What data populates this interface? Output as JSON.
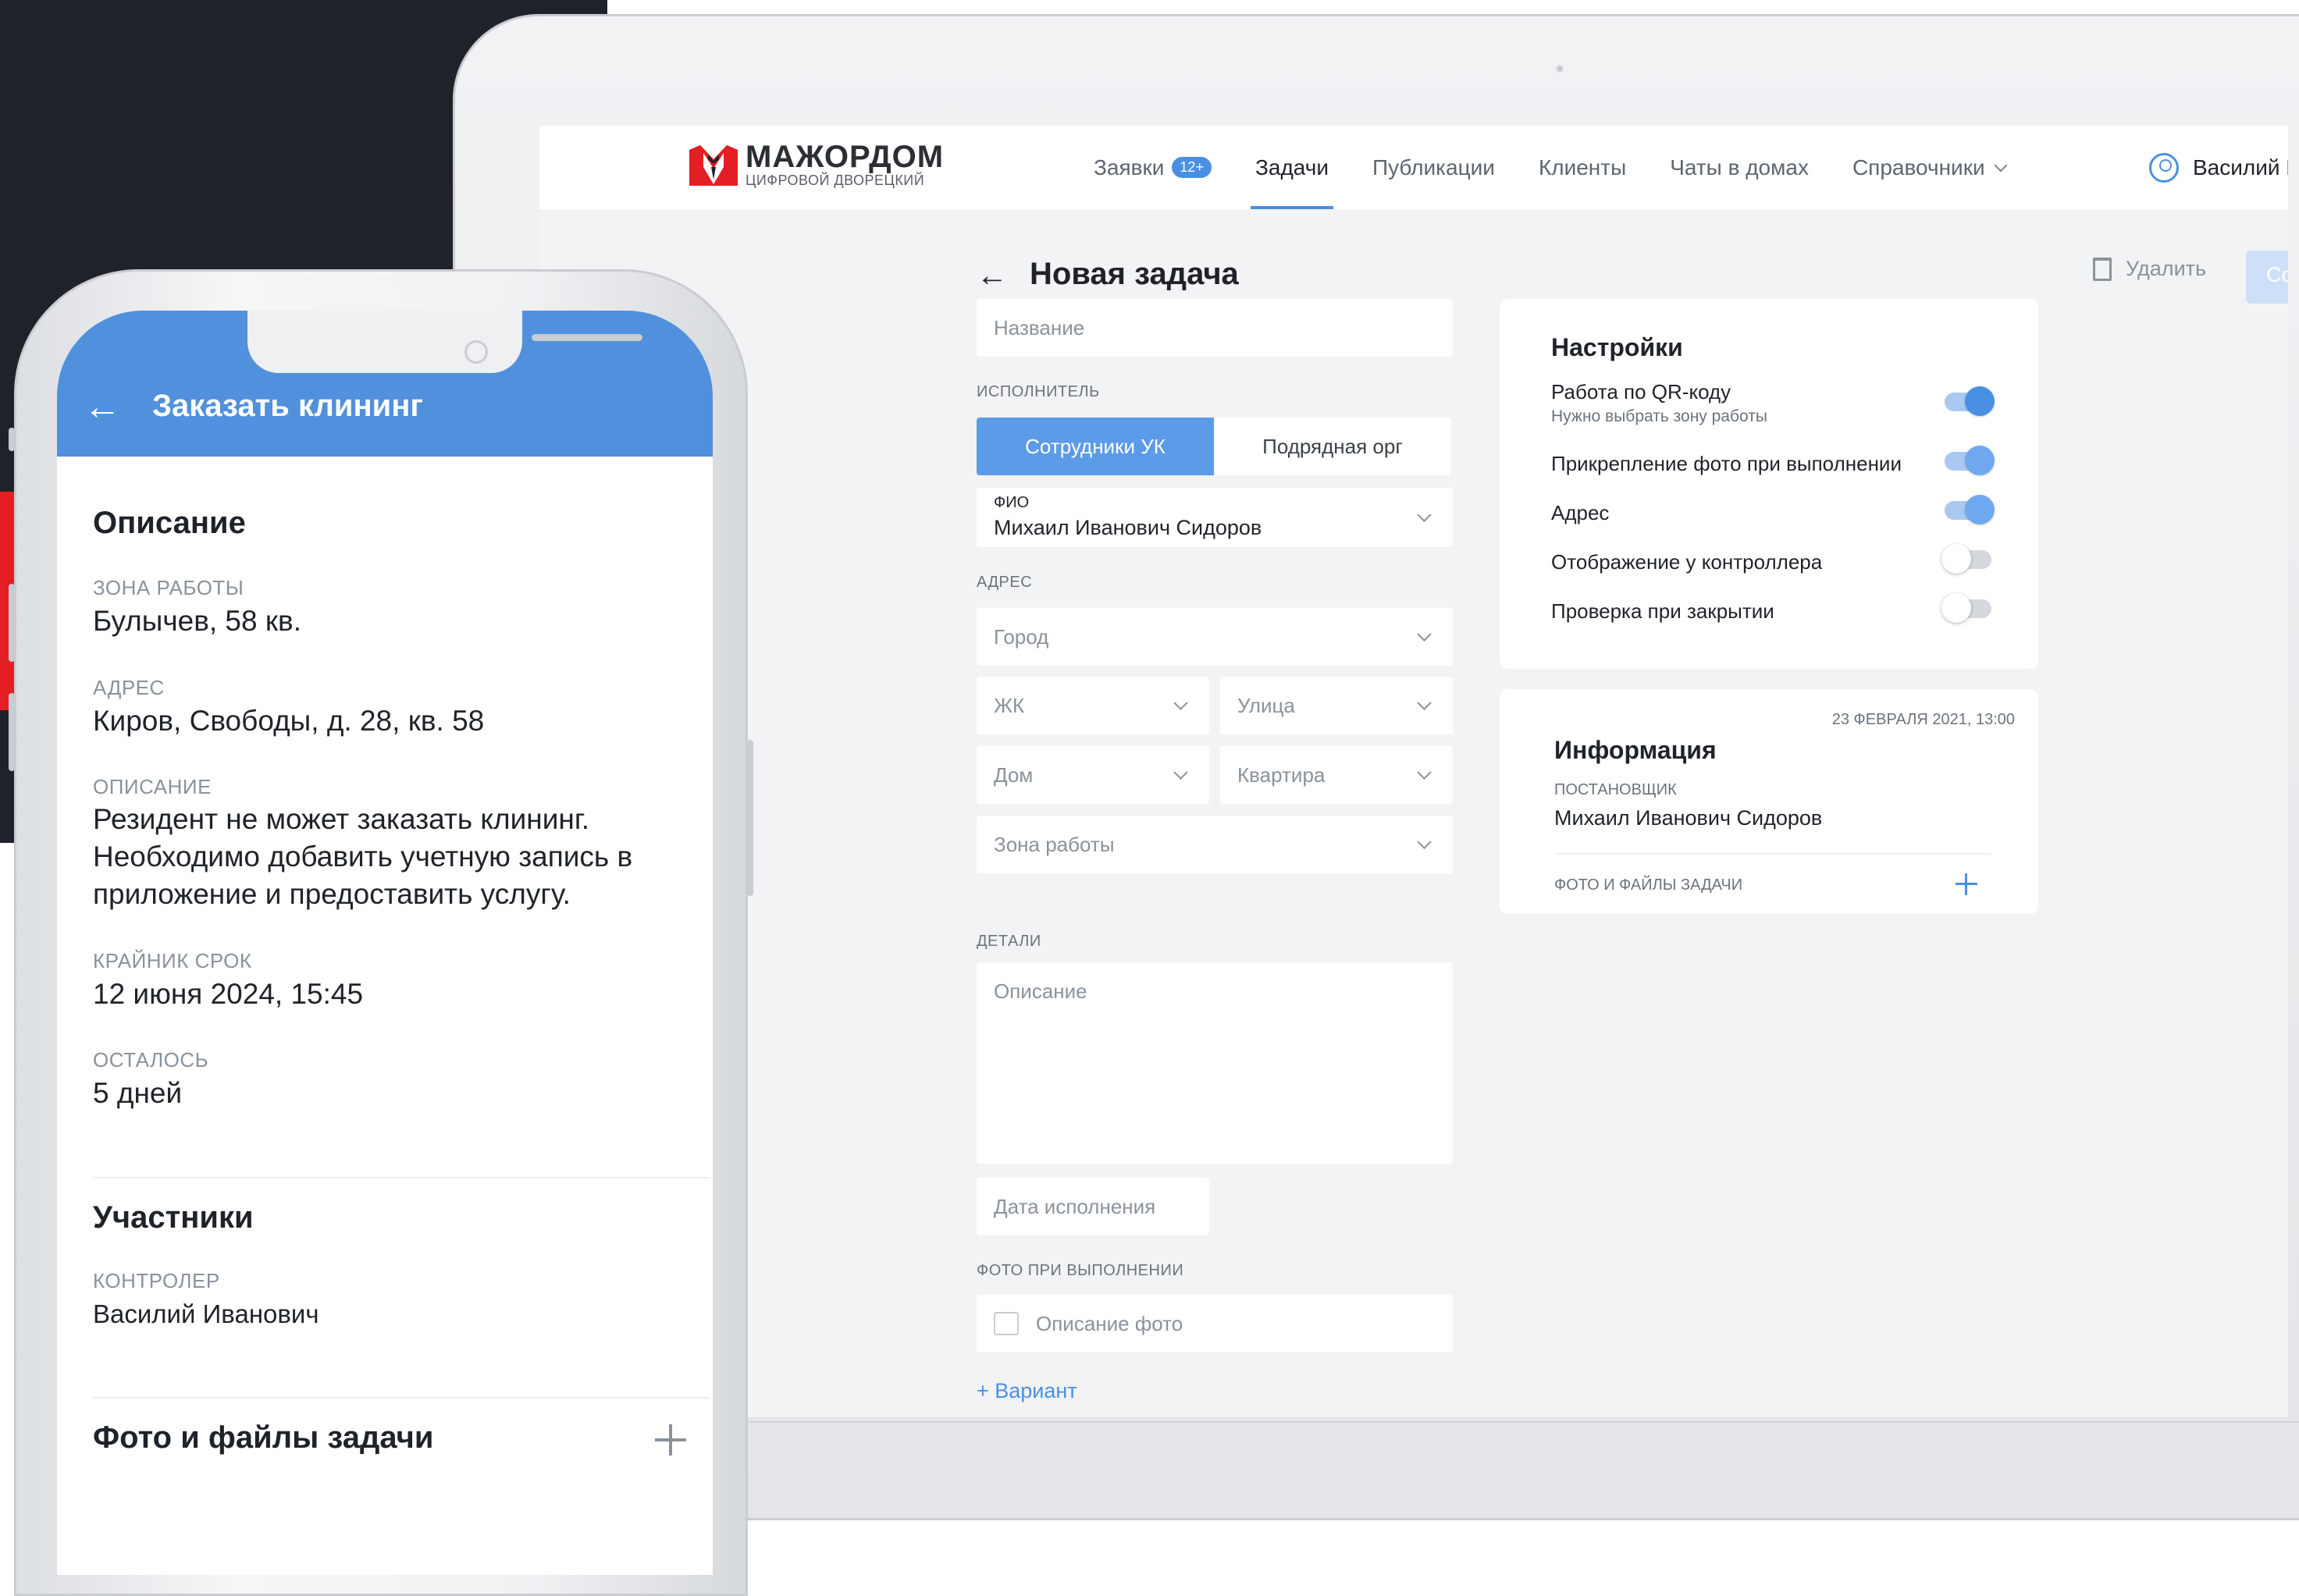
{
  "app": {
    "logo_title": "МАЖОРДОМ",
    "logo_sub": "ЦИФРОВОЙ ДВОРЕЦКИЙ",
    "nav": [
      {
        "label": "Заявки",
        "badge": "12+"
      },
      {
        "label": "Задачи"
      },
      {
        "label": "Публикации"
      },
      {
        "label": "Клиенты"
      },
      {
        "label": "Чаты в домах"
      },
      {
        "label": "Справочники"
      }
    ],
    "user": "Василий Г"
  },
  "page": {
    "title": "Новая задача",
    "delete": "Удалить",
    "save": "Сох"
  },
  "form": {
    "name_placeholder": "Название",
    "executor_label": "Исполнитель",
    "seg_a": "Сотрудники УК",
    "seg_b": "Подрядная орг",
    "fio_label": "ФИО",
    "fio_value": "Михаил Иванович Сидоров",
    "address_label": "Адрес",
    "city": "Город",
    "complex": "ЖК",
    "street": "Улица",
    "house": "Дом",
    "apartment": "Квартира",
    "zone": "Зона работы",
    "details_label": "Детали",
    "description": "Описание",
    "due_date": "Дата исполнения",
    "photo_label": "Фото при выполнении",
    "photo_desc": "Описание фото",
    "variant": "+ Вариант"
  },
  "settings": {
    "title": "Настройки",
    "rows": [
      {
        "label": "Работа по QR-коду",
        "hint": "Нужно выбрать зону работы",
        "on": true
      },
      {
        "label": "Прикрепление фото при выполнении",
        "on": true
      },
      {
        "label": "Адрес",
        "on": true
      },
      {
        "label": "Отображение у контроллера",
        "on": false
      },
      {
        "label": "Проверка при закрытии",
        "on": false
      }
    ]
  },
  "info": {
    "date": "23 ФЕВРАЛЯ 2021, 13:00",
    "title": "Информация",
    "author_label": "ПОСТАНОВЩИК",
    "author": "Михаил Иванович Сидоров",
    "files_label": "ФОТО И ФАЙЛЫ ЗАДАЧИ"
  },
  "phone": {
    "title": "Заказать клининг",
    "section_desc": "Описание",
    "zone_label": "ЗОНА РАБОТЫ",
    "zone": "Булычев, 58 кв.",
    "address_label": "АДРЕС",
    "address": "Киров, Свободы, д. 28, кв. 58",
    "desc_label": "ОПИСАНИЕ",
    "desc": "Резидент не может заказать клининг. Необходимо добавить учетную запись в приложение и предоставить услугу.",
    "deadline_label": "КРАЙНИК СРОК",
    "deadline": "12 июня 2024, 15:45",
    "left_label": "ОСТАЛОСЬ",
    "left": "5 дней",
    "section_members": "Участники",
    "controller_label": "КОНТРОЛЕР",
    "controller": "Василий Иванович",
    "section_files": "Фото и файлы задачи"
  },
  "colors": {
    "accent": "#4a90e2",
    "phone_header": "#5090dc",
    "dark_bg": "#1f2329",
    "brand_red": "#e31e24"
  }
}
